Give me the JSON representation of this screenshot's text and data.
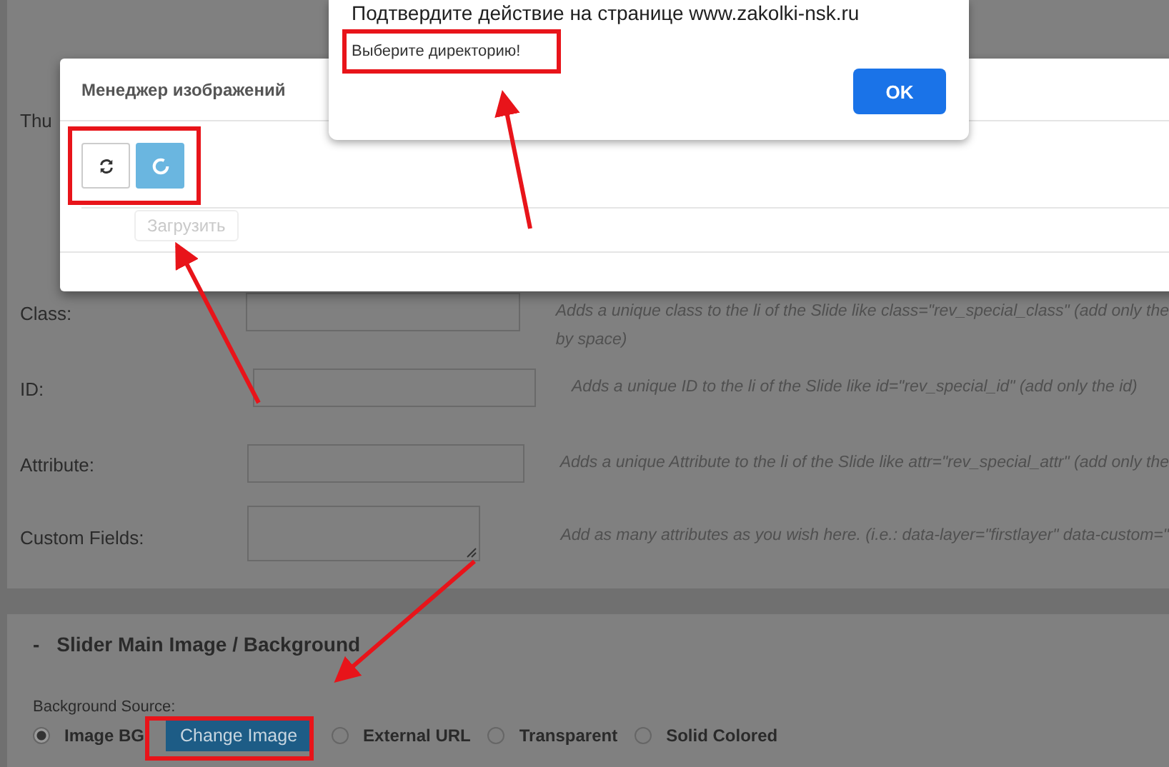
{
  "alert": {
    "title": "Подтвердите действие на странице www.zakolki-nsk.ru",
    "message": "Выберите директорию!",
    "ok_button": "OK"
  },
  "image_manager": {
    "title": "Менеджер изображений",
    "buttons": [
      {
        "kind": "refresh"
      },
      {
        "kind": "loading"
      }
    ],
    "tooltip": "Загрузить"
  },
  "settings": {
    "thumbnail_label": "Thu",
    "fields": [
      {
        "label": "Class:",
        "kind": "input",
        "hint": [
          "Adds a unique class to the li of the Slide like class=\"rev_special_class\" (add only the",
          "by space)"
        ]
      },
      {
        "label": "ID:",
        "kind": "input",
        "hint": [
          "Adds a unique ID to the li of the Slide like id=\"rev_special_id\" (add only the id)"
        ]
      },
      {
        "label": "Attribute:",
        "kind": "input",
        "hint": [
          "Adds a unique Attribute to the li of the Slide like attr=\"rev_special_attr\" (add only the"
        ]
      },
      {
        "label": "Custom Fields:",
        "kind": "textarea",
        "hint": [
          "Add as many attributes as you wish here. (i.e.: data-layer=\"firstlayer\" data-custom=\""
        ]
      }
    ]
  },
  "background": {
    "collapse": "-",
    "title": "Slider Main Image / Background",
    "source_label": "Background Source:",
    "options": [
      {
        "label": "Image BG",
        "selected": true,
        "button": "Change Image"
      },
      {
        "label": "External URL",
        "selected": false
      },
      {
        "label": "Transparent",
        "selected": false
      },
      {
        "label": "Solid Colored",
        "selected": false
      }
    ]
  }
}
